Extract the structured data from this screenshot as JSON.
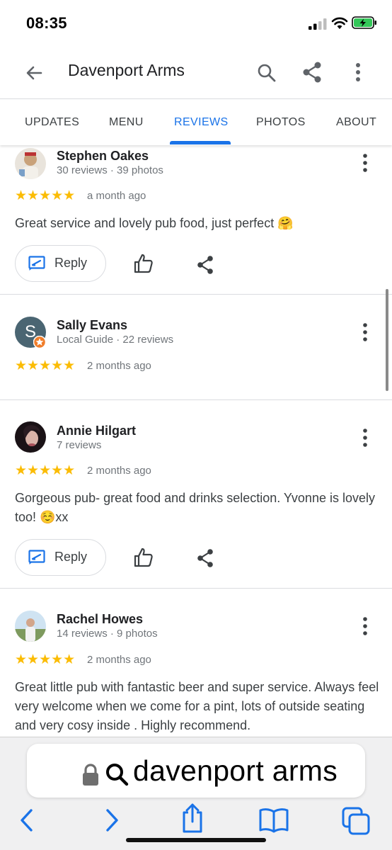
{
  "status_bar": {
    "time": "08:35"
  },
  "header": {
    "title": "Davenport Arms"
  },
  "tabs": [
    {
      "label": "UPDATES"
    },
    {
      "label": "MENU"
    },
    {
      "label": "REVIEWS",
      "active": true
    },
    {
      "label": "PHOTOS"
    },
    {
      "label": "ABOUT"
    }
  ],
  "reviews": [
    {
      "name": "Stephen Oakes",
      "meta": "30 reviews · 39 photos",
      "stars": "★★★★★",
      "rating": 5,
      "date": "a month ago",
      "text": "Great service and lovely pub food, just perfect 🤗",
      "reply_label": "Reply"
    },
    {
      "name": "Sally Evans",
      "meta": "Local Guide · 22 reviews",
      "avatar_letter": "S",
      "stars": "★★★★★",
      "rating": 5,
      "date": "2 months ago"
    },
    {
      "name": "Annie Hilgart",
      "meta": "7 reviews",
      "stars": "★★★★★",
      "rating": 5,
      "date": "2 months ago",
      "text": "Gorgeous pub- great food and drinks selection. Yvonne is lovely too! ☺️xx",
      "reply_label": "Reply"
    },
    {
      "name": "Rachel Howes",
      "meta": "14 reviews · 9 photos",
      "stars": "★★★★★",
      "rating": 5,
      "date": "2 months ago",
      "text": "Great little pub with fantastic beer and super service. Always feel very welcome when we come for a pint, lots of outside seating and very cosy inside . Highly recommend."
    }
  ],
  "browser": {
    "url_text": "davenport arms"
  },
  "colors": {
    "accent": "#1a73e8",
    "star": "#fbbc04",
    "sally_avatar": "#4a6572",
    "local_guide_badge": "#f07d2a"
  },
  "icons": [
    "back-arrow-icon",
    "search-icon",
    "share-icon",
    "more-vert-icon",
    "reply-icon",
    "thumb-up-icon",
    "lock-icon",
    "chevron-left-icon",
    "chevron-right-icon",
    "share-up-icon",
    "book-icon",
    "tabs-icon"
  ]
}
